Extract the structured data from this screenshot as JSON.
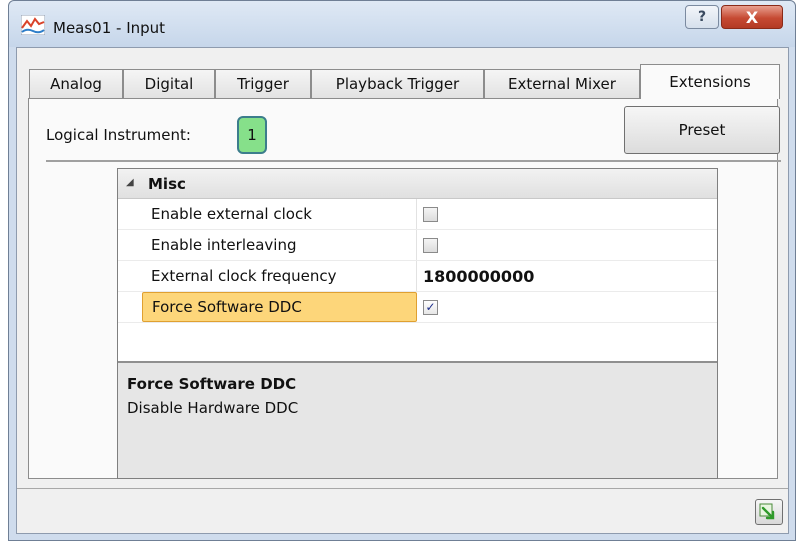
{
  "window": {
    "title": "Meas01 - Input",
    "help_label": "?",
    "close_label": "X"
  },
  "tabs": [
    {
      "label": "Analog"
    },
    {
      "label": "Digital"
    },
    {
      "label": "Trigger"
    },
    {
      "label": "Playback Trigger"
    },
    {
      "label": "External Mixer"
    },
    {
      "label": "Extensions",
      "active": true
    }
  ],
  "header": {
    "logical_instrument_label": "Logical Instrument:",
    "logical_instrument_value": "1",
    "preset_label": "Preset"
  },
  "propgrid": {
    "category": "Misc",
    "rows": [
      {
        "name": "Enable external clock",
        "type": "checkbox",
        "checked": false
      },
      {
        "name": "Enable interleaving",
        "type": "checkbox",
        "checked": false
      },
      {
        "name": "External clock frequency",
        "type": "text",
        "value": "1800000000"
      },
      {
        "name": "Force Software DDC",
        "type": "checkbox",
        "checked": true,
        "selected": true
      }
    ],
    "checkmark": "✓"
  },
  "description": {
    "title": "Force Software DDC",
    "text": "Disable Hardware DDC"
  },
  "colors": {
    "selection": "#fdd67a",
    "badge": "#86e08a",
    "close_button": "#c64a33"
  }
}
